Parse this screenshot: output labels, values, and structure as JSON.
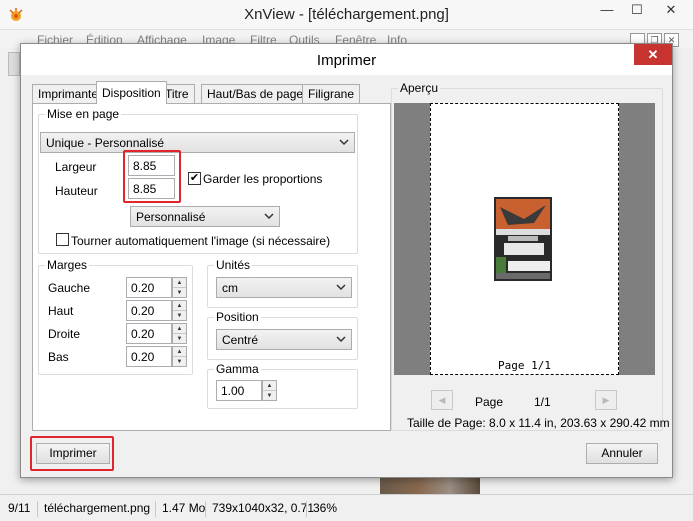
{
  "window": {
    "title": "XnView - [téléchargement.png]",
    "controls": {
      "minimize": "—",
      "maximize": "☐",
      "close": "✕"
    }
  },
  "menu": [
    "Fichier",
    "Édition",
    "Affichage",
    "Image",
    "Filtre",
    "Outils",
    "Fenêtre",
    "Info"
  ],
  "dialog": {
    "title": "Imprimer",
    "close": "✕",
    "tabs": [
      "Imprimante",
      "Disposition",
      "Titre",
      "Haut/Bas de page",
      "Filigrane"
    ],
    "active_tab": "Disposition",
    "layout": {
      "group_label": "Mise en page",
      "mode_value": "Unique - Personnalisé",
      "width_label": "Largeur",
      "width_value": "8.85",
      "height_label": "Hauteur",
      "height_value": "8.85",
      "keep_ratio_label": "Garder les proportions",
      "keep_ratio_checked": true,
      "size_value": "Personnalisé",
      "auto_rotate_label": "Tourner automatiquement l'image (si nécessaire)",
      "auto_rotate_checked": false
    },
    "margins": {
      "group_label": "Marges",
      "left_label": "Gauche",
      "left_value": "0.20",
      "top_label": "Haut",
      "top_value": "0.20",
      "right_label": "Droite",
      "right_value": "0.20",
      "bottom_label": "Bas",
      "bottom_value": "0.20"
    },
    "units": {
      "group_label": "Unités",
      "value": "cm"
    },
    "position": {
      "group_label": "Position",
      "value": "Centré"
    },
    "gamma": {
      "group_label": "Gamma",
      "value": "1.00"
    },
    "preview": {
      "group_label": "Aperçu",
      "page_footer": "Page 1/1",
      "page_label": "Page",
      "page_counter": "1/1",
      "page_size": "Taille de Page: 8.0 x 11.4 in, 203.63 x 290.42 mm",
      "background_color": "#7f7f7f"
    },
    "print_button": "Imprimer",
    "cancel_button": "Annuler"
  },
  "status_bar": {
    "index": "9/11",
    "filename": "téléchargement.png",
    "filesize": "1.47 Mo",
    "dimensions": "739x1040x32, 0.71",
    "zoom": "36%"
  },
  "colors": {
    "highlight": "#e0262c",
    "close_button": "#c7342f"
  }
}
